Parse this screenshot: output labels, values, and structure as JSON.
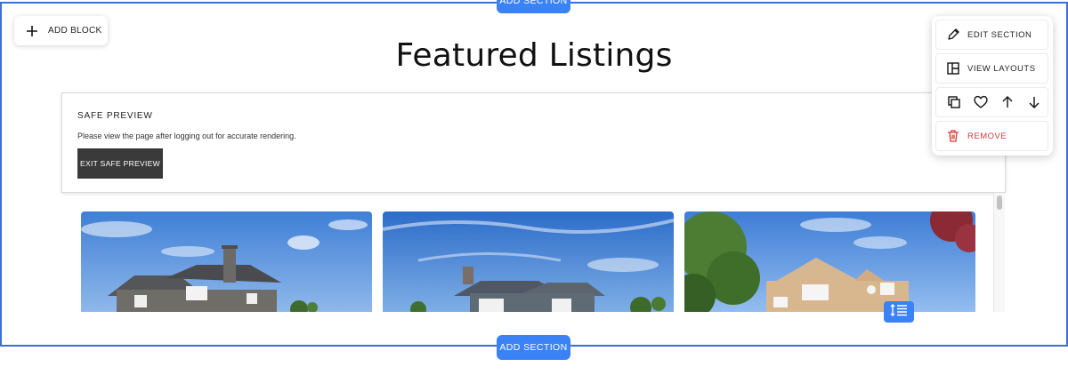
{
  "editor": {
    "add_section_label": "ADD SECTION",
    "add_block_label": "ADD BLOCK",
    "accent_color": "#3b82f6"
  },
  "page": {
    "title": "Featured Listings"
  },
  "safe_preview": {
    "title": "SAFE PREVIEW",
    "description": "Please view the page after logging out for accurate rendering.",
    "exit_label": "EXIT SAFE PREVIEW"
  },
  "section_toolbar": {
    "edit_label": "EDIT SECTION",
    "layouts_label": "VIEW LAYOUTS",
    "icons": [
      "duplicate-icon",
      "heart-icon",
      "arrow-up-icon",
      "arrow-down-icon"
    ],
    "remove_label": "REMOVE",
    "remove_color": "#d43a3a"
  },
  "listings": [
    {
      "image": "gray-craftsman-house"
    },
    {
      "image": "blue-gray-two-story-house"
    },
    {
      "image": "tan-victorian-house"
    }
  ]
}
